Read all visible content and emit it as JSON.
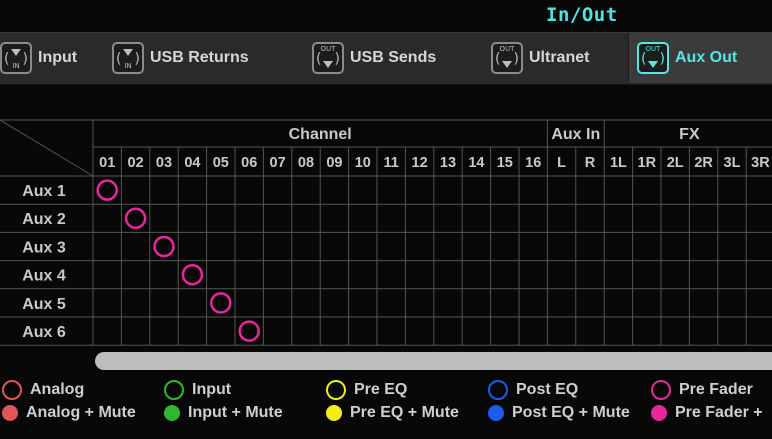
{
  "title": "In/Out",
  "tabs": [
    {
      "label": "Input",
      "icon": "input-icon",
      "icon_text": "IN",
      "active": false
    },
    {
      "label": "USB Returns",
      "icon": "usb-returns-icon",
      "icon_text": "IN",
      "active": false
    },
    {
      "label": "USB Sends",
      "icon": "usb-sends-icon",
      "icon_text": "OUT",
      "active": false
    },
    {
      "label": "Ultranet",
      "icon": "ultranet-icon",
      "icon_text": "OUT",
      "active": false
    },
    {
      "label": "Aux Out",
      "icon": "aux-out-icon",
      "icon_text": "OUT",
      "active": true
    }
  ],
  "matrix": {
    "groups": [
      {
        "label": "Channel"
      },
      {
        "label": "Aux In"
      },
      {
        "label": "FX"
      }
    ],
    "columns": [
      "01",
      "02",
      "03",
      "04",
      "05",
      "06",
      "07",
      "08",
      "09",
      "10",
      "11",
      "12",
      "13",
      "14",
      "15",
      "16",
      "L",
      "R",
      "1L",
      "1R",
      "2L",
      "2R",
      "3L",
      "3R"
    ],
    "rows": [
      "Aux 1",
      "Aux 2",
      "Aux 3",
      "Aux 4",
      "Aux 5",
      "Aux 6"
    ],
    "routes": [
      {
        "row": 0,
        "col": 0,
        "type": "Pre Fader"
      },
      {
        "row": 1,
        "col": 1,
        "type": "Pre Fader"
      },
      {
        "row": 2,
        "col": 2,
        "type": "Pre Fader"
      },
      {
        "row": 3,
        "col": 3,
        "type": "Pre Fader"
      },
      {
        "row": 4,
        "col": 4,
        "type": "Pre Fader"
      },
      {
        "row": 5,
        "col": 5,
        "type": "Pre Fader"
      }
    ]
  },
  "legend": [
    {
      "label": "Analog",
      "color": "#e05555",
      "filled": false
    },
    {
      "label": "Input",
      "color": "#2fb82f",
      "filled": false
    },
    {
      "label": "Pre EQ",
      "color": "#f2ee14",
      "filled": false
    },
    {
      "label": "Post EQ",
      "color": "#1a5cf0",
      "filled": false
    },
    {
      "label": "Pre Fader",
      "color": "#e8269e",
      "filled": false
    },
    {
      "label": "Analog + Mute",
      "color": "#e05555",
      "filled": true
    },
    {
      "label": "Input + Mute",
      "color": "#2fb82f",
      "filled": true
    },
    {
      "label": "Pre EQ + Mute",
      "color": "#f2ee14",
      "filled": true
    },
    {
      "label": "Post EQ + Mute",
      "color": "#1a5cf0",
      "filled": true
    },
    {
      "label": "Pre Fader +",
      "color": "#e8269e",
      "filled": true
    }
  ],
  "colors": {
    "accent": "#56e6e3",
    "route_pre_fader": "#e8269e"
  }
}
